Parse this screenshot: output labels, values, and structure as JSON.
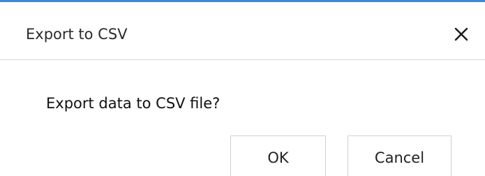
{
  "dialog": {
    "title": "Export to CSV",
    "message": "Export data to CSV file?",
    "close_icon": "close-icon",
    "accent_color": "#3f89d4",
    "buttons": {
      "ok_label": "OK",
      "cancel_label": "Cancel"
    }
  }
}
